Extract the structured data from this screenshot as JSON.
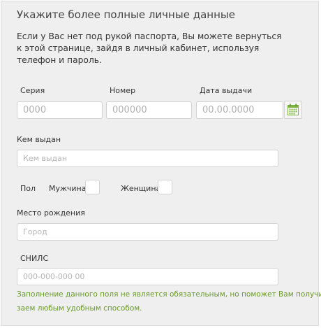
{
  "form": {
    "title": "Укажите более полные личные данные",
    "intro_lines": [
      "Если у Вас нет под рукой паспорта, Вы можете вернуться",
      "к этой странице, зайдя в личный кабинет, используя",
      "телефон и пароль."
    ],
    "passport": {
      "series_label": "Серия",
      "series_placeholder": "0000",
      "number_label": "Номер",
      "number_placeholder": "000000",
      "date_label": "Дата выдачи",
      "date_placeholder": "00.00.0000",
      "calendar_icon": "calendar-icon"
    },
    "issued_by": {
      "label": "Кем выдан",
      "placeholder": "Кем выдан"
    },
    "gender": {
      "label": "Пол",
      "male_label": "Мужчина",
      "female_label": "Женщина"
    },
    "birthplace": {
      "label": "Место рождения",
      "placeholder": "Город"
    },
    "snils": {
      "label": "СНИЛС",
      "placeholder": "000-000-000 00"
    },
    "hint_lines": [
      "Заполнение данного поля не является обязательным, но поможет Вам получить",
      "заем любым удобным способом."
    ]
  },
  "colors": {
    "panel_bg": "#efefef",
    "hint_green": "#6a9a2c",
    "calendar_green": "#7cb342"
  }
}
